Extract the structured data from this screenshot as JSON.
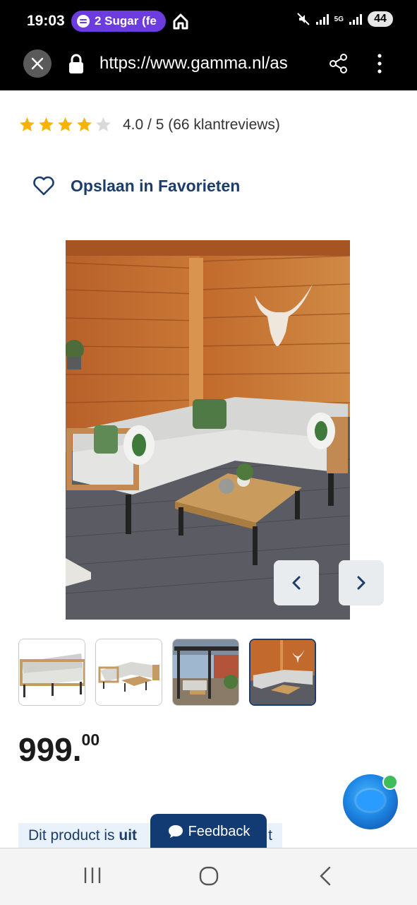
{
  "status_bar": {
    "time": "19:03",
    "media_pill": "2 Sugar (fe",
    "network": "5G",
    "battery": "44"
  },
  "browser": {
    "url": "https://www.gamma.nl/as"
  },
  "rating": {
    "stars_filled": 4,
    "stars_total": 5,
    "text": "4.0 / 5 (66 klantreviews)"
  },
  "favorites": {
    "label": "Opslaan in Favorieten"
  },
  "gallery": {
    "selected_index": 4,
    "thumbnail_count": 4
  },
  "price": {
    "integer": "999",
    "separator": ".",
    "decimals": "00"
  },
  "availability": {
    "prefix": "Dit product is ",
    "bold": "uit",
    "suffix": "t"
  },
  "feedback": {
    "label": "Feedback"
  },
  "colors": {
    "brand_blue": "#1c3d6b",
    "feedback_bg": "#123a73",
    "star": "#f6b400",
    "media_pill": "#6d3ce0",
    "chat_online": "#3ebd5a"
  },
  "icons": {
    "close": "close-icon",
    "lock": "lock-icon",
    "share": "share-icon",
    "menu": "more-vert-icon",
    "favorite": "heart-icon",
    "prev": "chevron-left-icon",
    "next": "chevron-right-icon",
    "chat": "chat-bubble-icon"
  }
}
